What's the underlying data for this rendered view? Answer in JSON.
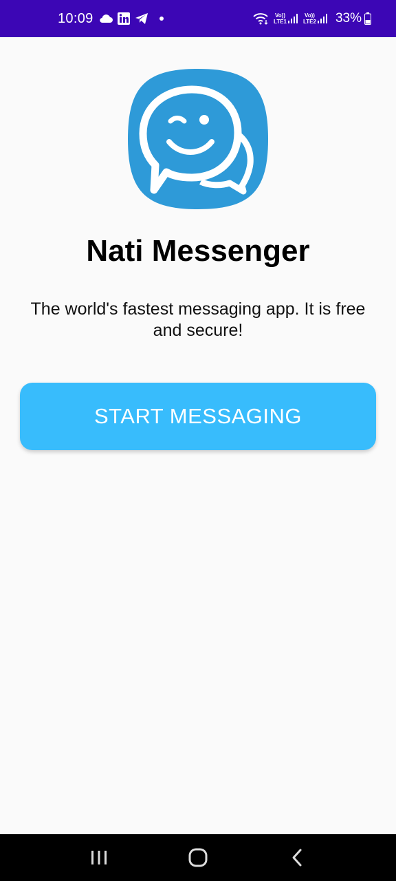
{
  "status_bar": {
    "time": "10:09",
    "icons": [
      "cloud-icon",
      "linkedin-icon",
      "telegram-icon",
      "notification-dot"
    ],
    "sim1_label_top": "Vo))",
    "sim1_label_bottom": "LTE1",
    "sim2_label_top": "Vo))",
    "sim2_label_bottom": "LTE2",
    "battery_percent": "33%",
    "background_color": "#3c06b5"
  },
  "main": {
    "logo_icon": "winking-chat-bubble-icon",
    "logo_color": "#2e9ad8",
    "title": "Nati Messenger",
    "tagline": "The world's fastest messaging app. It is free and secure!",
    "start_button_label": "START MESSAGING",
    "button_color": "#38bcfc"
  },
  "nav_bar": {
    "recents_icon": "recents-icon",
    "home_icon": "home-icon",
    "back_icon": "back-icon"
  }
}
